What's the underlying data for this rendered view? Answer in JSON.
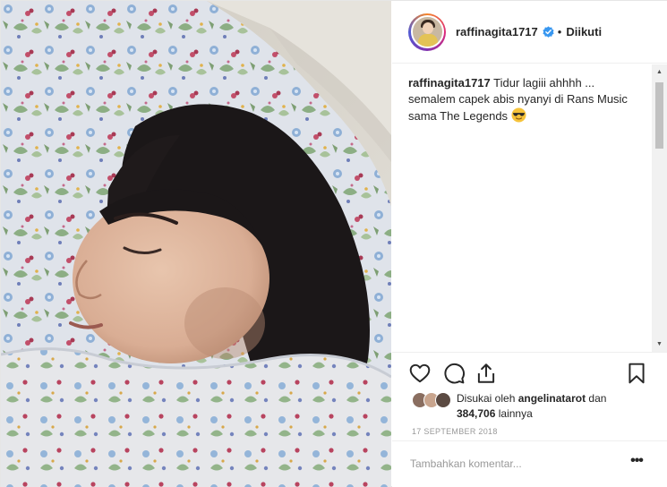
{
  "post": {
    "username": "raffinagita1717",
    "separator": "•",
    "follow_status": "Diikuti",
    "caption_user": "raffinagita1717",
    "caption_text": "Tidur lagiii ahhhh ... semalem capek abis nyanyi di Rans Music sama The Legends",
    "caption_emoji": "smiling-face-with-sunglasses",
    "likes_prefix": "Disukai oleh",
    "likes_user": "angelinatarot",
    "likes_mid": "dan",
    "likes_count": "384,706",
    "likes_suffix": "lainnya",
    "date": "17 SEPTEMBER 2018",
    "comment_placeholder": "Tambahkan komentar...",
    "more_label": "•••"
  },
  "icons": {
    "verified": "verified-badge-icon",
    "like": "heart-icon",
    "comment": "comment-bubble-icon",
    "share": "share-icon",
    "save": "bookmark-icon",
    "more": "more-options-icon"
  },
  "colors": {
    "verified_blue": "#3897f0",
    "text": "#262626",
    "muted": "#999999",
    "border": "#efefef"
  }
}
